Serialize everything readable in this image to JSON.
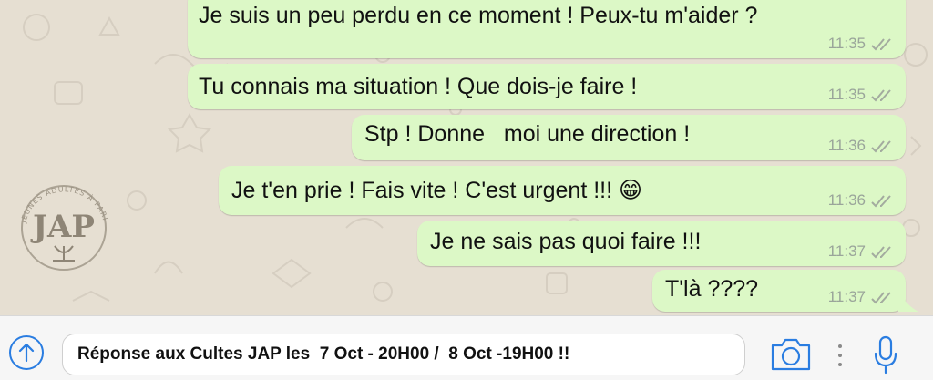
{
  "messages": [
    {
      "text": "Je suis un peu perdu en ce moment ! Peux-tu m'aider ?",
      "time": "11:35",
      "status": "read"
    },
    {
      "text": "Tu connais ma situation ! Que dois-je faire !",
      "time": "11:35",
      "status": "read"
    },
    {
      "text": "Stp ! Donne   moi une direction !",
      "time": "11:36",
      "status": "read"
    },
    {
      "text": "Je t'en prie ! Fais vite ! C'est urgent !!! 😁",
      "time": "11:36",
      "status": "read"
    },
    {
      "text": "Je ne sais pas quoi faire !!!",
      "time": "11:37",
      "status": "read"
    },
    {
      "text": "T'là ????",
      "time": "11:37",
      "status": "read"
    }
  ],
  "logo": {
    "monogram": "JAP",
    "arc_text": "JEUNES ADULTES À PARIS"
  },
  "composer": {
    "value": "Réponse aux Cultes JAP les  7 Oct - 20H00 /  8 Oct -19H00 !!"
  },
  "icons": {
    "upload": "upload-arrow-icon",
    "camera": "camera-icon",
    "more": "more-vertical-icon",
    "mic": "microphone-icon",
    "ticks": "double-check-icon"
  },
  "colors": {
    "bubble_out": "#dcf8c6",
    "chat_bg": "#e6dfd2",
    "accent": "#2a7de1",
    "meta_text": "#9aa59a"
  }
}
